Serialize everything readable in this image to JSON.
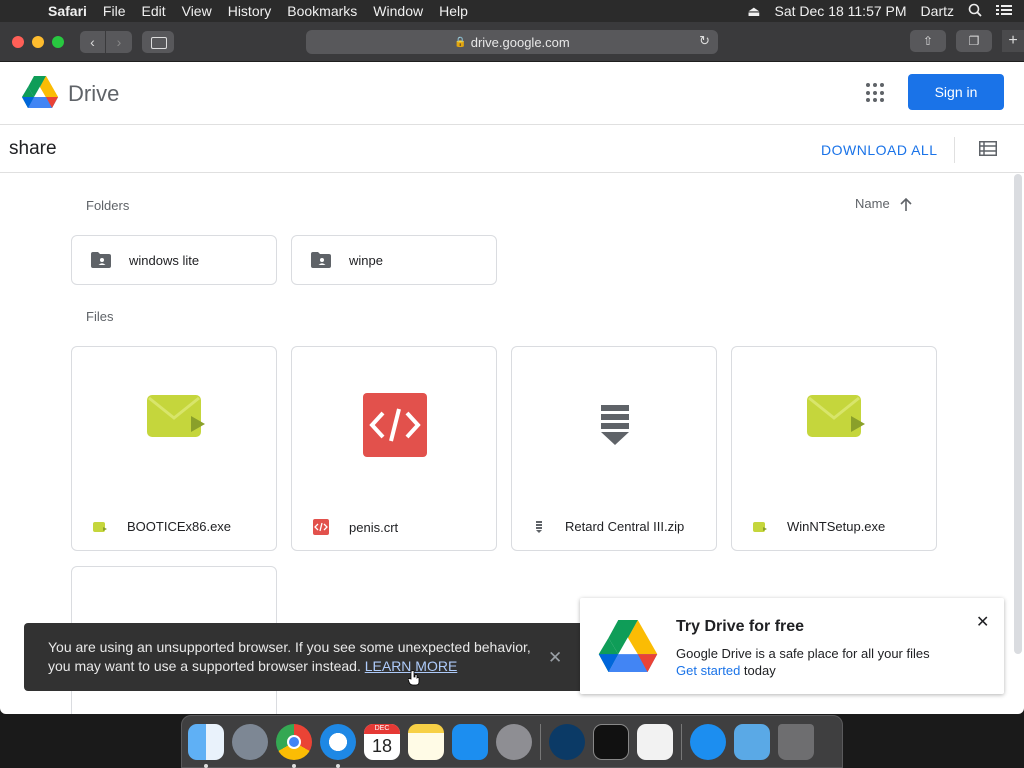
{
  "menubar": {
    "app": "Safari",
    "items": [
      "File",
      "Edit",
      "View",
      "History",
      "Bookmarks",
      "Window",
      "Help"
    ],
    "clock": "Sat Dec 18  11:57 PM",
    "user": "Dartz"
  },
  "browser": {
    "url": "drive.google.com"
  },
  "drive": {
    "brand": "Drive",
    "signin_label": "Sign in",
    "folder_title": "share",
    "download_all_label": "DOWNLOAD ALL",
    "folders_label": "Folders",
    "files_label": "Files",
    "sort_label": "Name",
    "folders": [
      {
        "name": "windows lite"
      },
      {
        "name": "winpe"
      }
    ],
    "files": [
      {
        "name": "BOOTICEx86.exe",
        "icon": "exe-icon"
      },
      {
        "name": "penis.crt",
        "icon": "code-icon"
      },
      {
        "name": "Retard Central III.zip",
        "icon": "zip-icon"
      },
      {
        "name": "WinNTSetup.exe",
        "icon": "exe-icon"
      }
    ]
  },
  "toast": {
    "message": "You are using an unsupported browser. If you see some unexpected behavior, you may want to use a supported browser instead.",
    "link": "LEARN MORE"
  },
  "promo": {
    "title": "Try Drive for free",
    "description": "Google Drive is a safe place for all your files",
    "link": "Get started",
    "suffix": " today"
  },
  "dock": {
    "calendar_month": "DEC",
    "calendar_day": "18"
  },
  "colors": {
    "accent": "#1a73e8",
    "exe": "#c5d63c",
    "code": "#e2514c",
    "zip": "#5f6368"
  }
}
